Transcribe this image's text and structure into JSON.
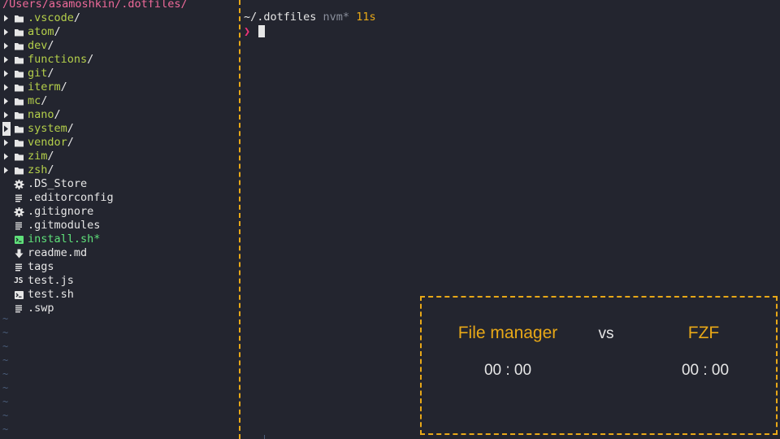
{
  "colors": {
    "background": "#23252f",
    "text": "#e6e6e6",
    "path_pink": "#ef6a9a",
    "folder_green": "#b4cf4a",
    "executable_green": "#5fe07a",
    "muted_grey": "#8a8f9c",
    "yellow_accent": "#e8a817",
    "prompt_pink": "#f0327a",
    "tilde_blue": "#4a5d7a"
  },
  "tree": {
    "path": "/Users/asamoshkin/.dotfiles/",
    "items": [
      {
        "name": ".vscode",
        "suffix": "/",
        "kind": "folder",
        "icon": "folder-icon",
        "color": "#b4cf4a"
      },
      {
        "name": "atom",
        "suffix": "/",
        "kind": "folder",
        "icon": "folder-icon",
        "color": "#b4cf4a"
      },
      {
        "name": "dev",
        "suffix": "/",
        "kind": "folder",
        "icon": "folder-icon",
        "color": "#b4cf4a"
      },
      {
        "name": "functions",
        "suffix": "/",
        "kind": "folder",
        "icon": "folder-icon",
        "color": "#b4cf4a"
      },
      {
        "name": "git",
        "suffix": "/",
        "kind": "folder",
        "icon": "folder-icon",
        "color": "#b4cf4a"
      },
      {
        "name": "iterm",
        "suffix": "/",
        "kind": "folder",
        "icon": "folder-icon",
        "color": "#b4cf4a"
      },
      {
        "name": "mc",
        "suffix": "/",
        "kind": "folder",
        "icon": "folder-icon",
        "color": "#b4cf4a"
      },
      {
        "name": "nano",
        "suffix": "/",
        "kind": "folder",
        "icon": "folder-icon",
        "color": "#b4cf4a"
      },
      {
        "name": "system",
        "suffix": "/",
        "kind": "folder",
        "icon": "folder-icon",
        "color": "#b4cf4a",
        "cursor": true
      },
      {
        "name": "vendor",
        "suffix": "/",
        "kind": "folder",
        "icon": "folder-icon",
        "color": "#b4cf4a"
      },
      {
        "name": "zim",
        "suffix": "/",
        "kind": "folder",
        "icon": "folder-icon",
        "color": "#b4cf4a"
      },
      {
        "name": "zsh",
        "suffix": "/",
        "kind": "folder",
        "icon": "folder-icon",
        "color": "#b4cf4a"
      },
      {
        "name": ".DS_Store",
        "suffix": "",
        "kind": "file",
        "icon": "gear-icon",
        "color": "#e6e6e6"
      },
      {
        "name": ".editorconfig",
        "suffix": "",
        "kind": "file",
        "icon": "text-lines-icon",
        "color": "#e6e6e6"
      },
      {
        "name": ".gitignore",
        "suffix": "",
        "kind": "file",
        "icon": "gear-icon",
        "color": "#e6e6e6"
      },
      {
        "name": ".gitmodules",
        "suffix": "",
        "kind": "file",
        "icon": "text-lines-icon",
        "color": "#e6e6e6"
      },
      {
        "name": "install.sh*",
        "suffix": "",
        "kind": "file",
        "icon": "terminal-icon",
        "color": "#5fe07a"
      },
      {
        "name": "readme.md",
        "suffix": "",
        "kind": "file",
        "icon": "down-arrow-icon",
        "color": "#e6e6e6"
      },
      {
        "name": "tags",
        "suffix": "",
        "kind": "file",
        "icon": "text-lines-icon",
        "color": "#e6e6e6"
      },
      {
        "name": "test.js",
        "suffix": "",
        "kind": "file",
        "icon": "js-icon",
        "color": "#e6e6e6"
      },
      {
        "name": "test.sh",
        "suffix": "",
        "kind": "file",
        "icon": "terminal-icon",
        "color": "#e6e6e6"
      },
      {
        "name": ".swp",
        "suffix": "",
        "kind": "file",
        "icon": "text-lines-icon",
        "color": "#e6e6e6"
      }
    ],
    "empty_line_marker": "~",
    "empty_line_count": 9
  },
  "terminal": {
    "cwd": "~/.dotfiles",
    "branch": "nvm*",
    "duration": "11s",
    "prompt_symbol": "❯"
  },
  "scoreboard": {
    "left_title": "File manager",
    "vs": "vs",
    "right_title": "FZF",
    "left_timer": "00 : 00",
    "right_timer": "00 : 00"
  }
}
